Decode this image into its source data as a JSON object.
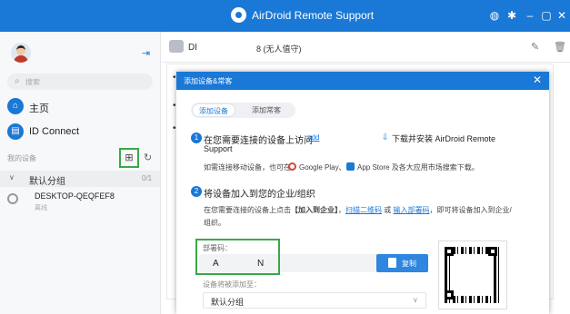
{
  "app": {
    "title": "AirDroid Remote Support"
  },
  "titlebar": {
    "icons": [
      "globe-icon",
      "gear-icon",
      "minimize-icon",
      "maximize-icon",
      "close-icon"
    ]
  },
  "sidebar": {
    "search_placeholder": "搜索",
    "nav": [
      {
        "label": "主页",
        "icon": "home-icon"
      },
      {
        "label": "ID Connect",
        "icon": "id-connect-icon"
      }
    ],
    "section_title": "我的设备",
    "group": {
      "name": "默认分组",
      "count": "0/1"
    },
    "device": {
      "name": "DESKTOP-QEQFEF8",
      "status": "离线"
    }
  },
  "main": {
    "name": "DI",
    "count": "8 (无人值守)",
    "bullets": [
      "•",
      "•",
      "•"
    ]
  },
  "dialog": {
    "title": "添加设备&常客",
    "tabs": [
      {
        "label": "添加设备",
        "active": true
      },
      {
        "label": "添加常客",
        "active": false
      }
    ],
    "step1": {
      "num": "1",
      "text": "在您需要连接的设备上访问",
      "link": "add",
      "download_text": "下载并安装 AirDroid Remote",
      "download_text2": "Support",
      "mobile_note_pre": "如需连接移动设备，也可在",
      "google_play": "Google Play、",
      "app_store": "App Store 及各大应用市场搜索下载。"
    },
    "step2": {
      "num": "2",
      "text": "将设备加入到您的企业/组织",
      "line1_pre": "在您需要连接的设备上点击",
      "line1_bold": "【加入到企业】",
      "line1_mid": "，",
      "scan_link": "扫描二维码",
      "or": "或",
      "input_link": "输入部署码",
      "line1_post": "，即可将设备加入到企业/",
      "line2": "组织。"
    },
    "code": {
      "label": "部署码：",
      "value_a": "A",
      "value_n": "N"
    },
    "copy_button": "复制",
    "add_to_label": "设备将被添加至：",
    "group_select": "默认分组"
  },
  "colors": {
    "brand": "#1a78d6",
    "highlight": "#3aa84a"
  }
}
